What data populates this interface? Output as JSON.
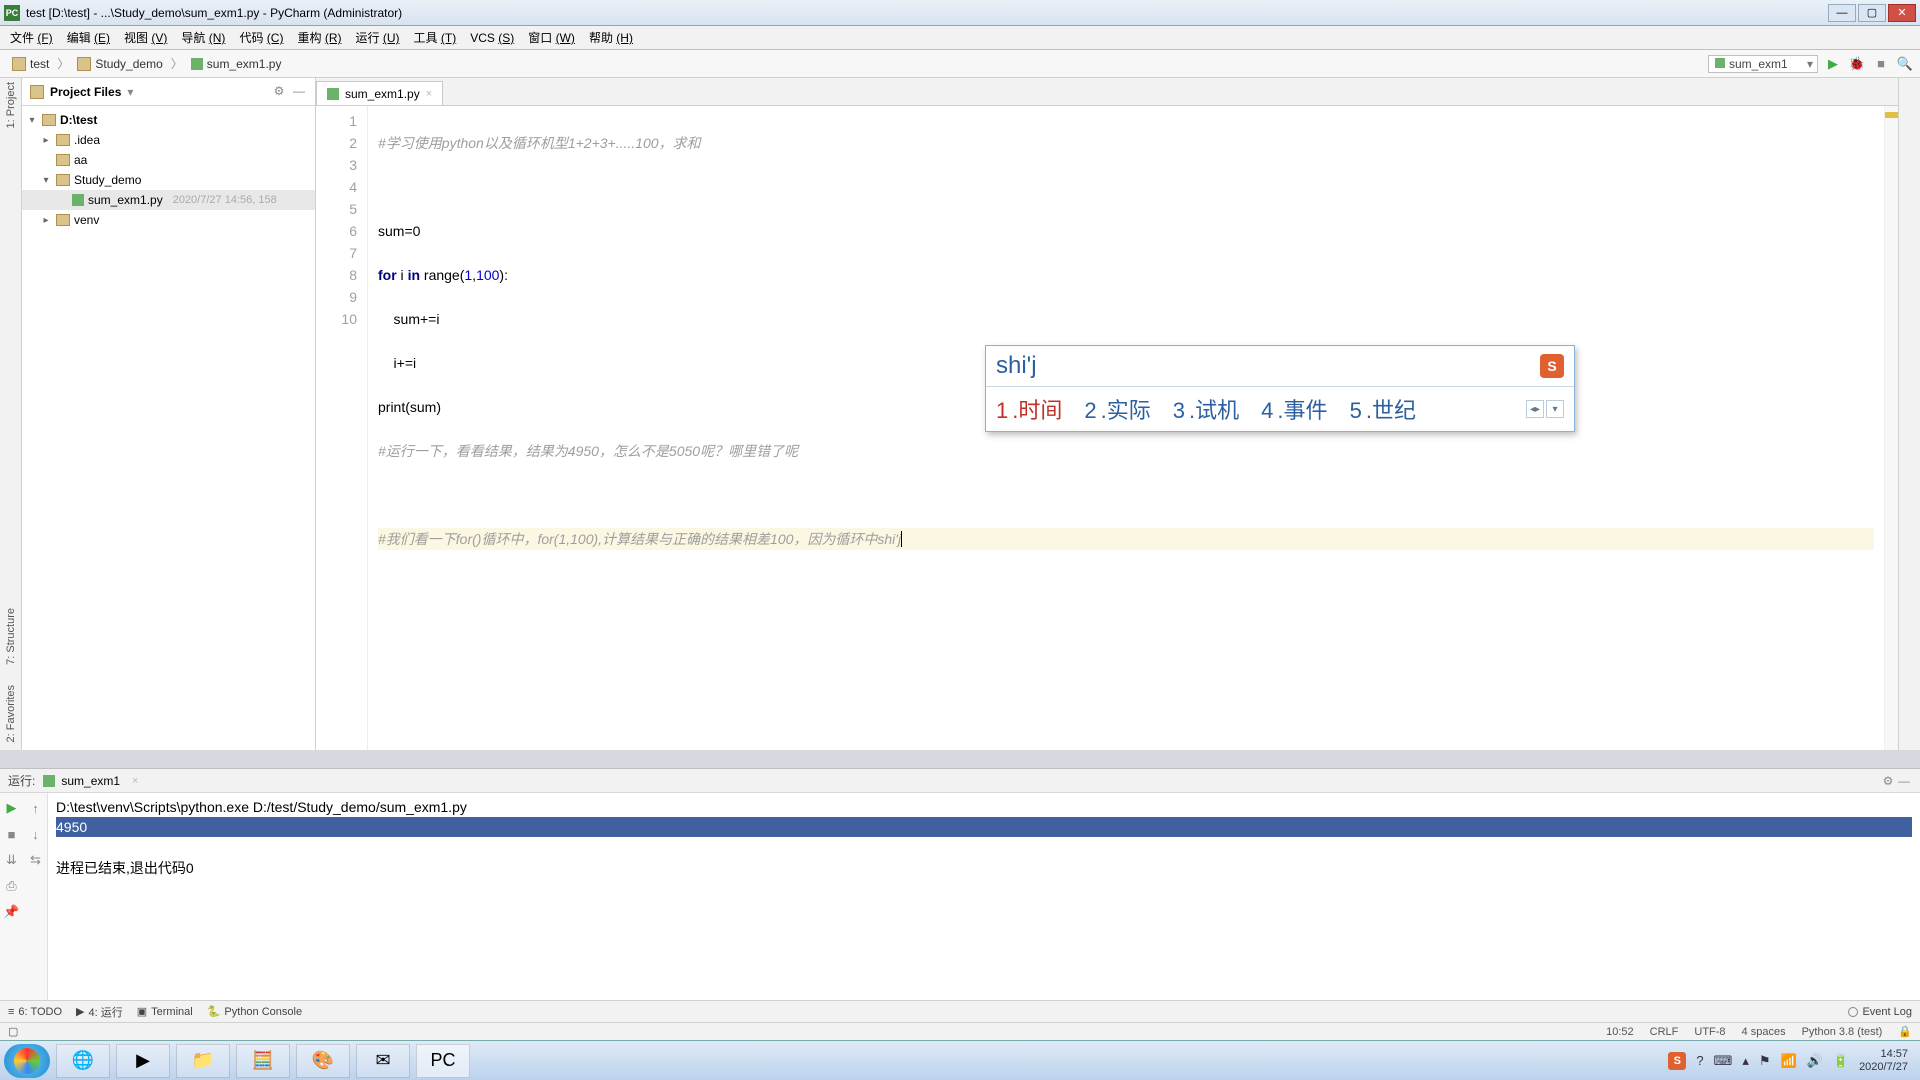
{
  "window": {
    "title": "test [D:\\test] - ...\\Study_demo\\sum_exm1.py - PyCharm (Administrator)"
  },
  "menu": {
    "items": [
      {
        "label": "文件",
        "accel": "(F)"
      },
      {
        "label": "编辑",
        "accel": "(E)"
      },
      {
        "label": "视图",
        "accel": "(V)"
      },
      {
        "label": "导航",
        "accel": "(N)"
      },
      {
        "label": "代码",
        "accel": "(C)"
      },
      {
        "label": "重构",
        "accel": "(R)"
      },
      {
        "label": "运行",
        "accel": "(U)"
      },
      {
        "label": "工具",
        "accel": "(T)"
      },
      {
        "label": "VCS",
        "accel": "(S)"
      },
      {
        "label": "窗口",
        "accel": "(W)"
      },
      {
        "label": "帮助",
        "accel": "(H)"
      }
    ]
  },
  "breadcrumb": {
    "items": [
      "test",
      "Study_demo",
      "sum_exm1.py"
    ]
  },
  "runconfig": {
    "selected": "sum_exm1"
  },
  "sidebar": {
    "title": "Project Files",
    "tree": {
      "root": {
        "label": "D:\\test"
      },
      "idea": {
        "label": ".idea"
      },
      "aa": {
        "label": "aa"
      },
      "study": {
        "label": "Study_demo"
      },
      "file": {
        "label": "sum_exm1.py",
        "meta": "2020/7/27 14:56, 158"
      },
      "venv": {
        "label": "venv"
      }
    }
  },
  "left_gutter": {
    "project": "1: Project",
    "structure": "7: Structure",
    "fav": "2: Favorites"
  },
  "editor": {
    "tab": "sum_exm1.py",
    "lines": {
      "l1": "#学习使用python以及循环机型1+2+3+.....100，求和",
      "l3": "sum=0",
      "l4a": "for",
      "l4b": " i ",
      "l4c": "in",
      "l4d": " range(",
      "l4e": "1",
      "l4f": ",",
      "l4g": "100",
      "l4h": "):",
      "l5": "    sum+=i",
      "l6": "    i+=i",
      "l7": "print(sum)",
      "l8": "#运行一下，看看结果，结果为4950，怎么不是5050呢？哪里错了呢",
      "l10": "#我们看一下for()循环中，for(1,100),计算结果与正确的结果相差100，因为循环中shi'j"
    },
    "line_count": 10
  },
  "ime": {
    "input": "shi'j",
    "cands": [
      {
        "n": "1",
        "t": "时间"
      },
      {
        "n": "2",
        "t": "实际"
      },
      {
        "n": "3",
        "t": "试机"
      },
      {
        "n": "4",
        "t": "事件"
      },
      {
        "n": "5",
        "t": "世纪"
      }
    ]
  },
  "run": {
    "title": "运行:",
    "tab": "sum_exm1",
    "cmd": "D:\\test\\venv\\Scripts\\python.exe D:/test/Study_demo/sum_exm1.py",
    "out": "4950",
    "exit": "进程已结束,退出代码0"
  },
  "bottom_tabs": {
    "todo": "6: TODO",
    "run": "4: 运行",
    "terminal": "Terminal",
    "pyconsole": "Python Console",
    "eventlog": "Event Log"
  },
  "status": {
    "pos": "10:52",
    "eol": "CRLF",
    "enc": "UTF-8",
    "indent": "4 spaces",
    "interp": "Python 3.8 (test)"
  },
  "taskbar": {
    "time": "14:57",
    "date": "2020/7/27"
  }
}
